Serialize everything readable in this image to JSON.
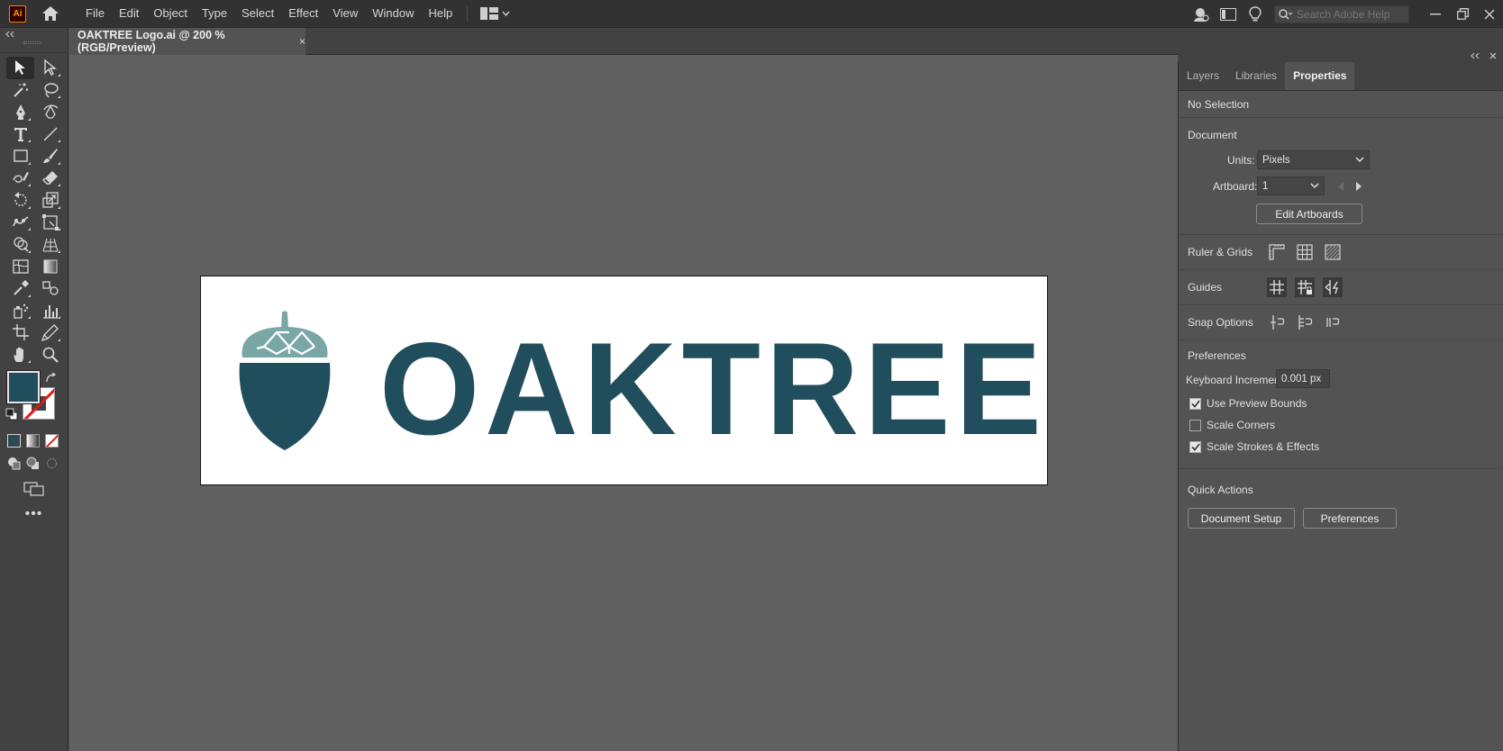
{
  "app": {
    "logo_text": "Ai",
    "menus": [
      "File",
      "Edit",
      "Object",
      "Type",
      "Select",
      "Effect",
      "View",
      "Window",
      "Help"
    ],
    "search_placeholder": "Search Adobe Help"
  },
  "document": {
    "tab_title": "OAKTREE Logo.ai @ 200 % (RGB/Preview)",
    "close_glyph": "×",
    "logo_text": "OAKTREE"
  },
  "colors": {
    "fill": "#214e5c",
    "acorn_cap": "#7aa6a6",
    "canvas": "#616161",
    "accent_red": "#e01b1b"
  },
  "toolbar": {
    "more_label": "•••",
    "tools": [
      "selection-tool",
      "direct-selection-tool",
      "magic-wand-tool",
      "lasso-tool",
      "pen-tool",
      "curvature-tool",
      "type-tool",
      "line-segment-tool",
      "rectangle-tool",
      "paintbrush-tool",
      "shaper-tool",
      "eraser-tool",
      "rotate-tool",
      "scale-tool",
      "puppet-warp-tool",
      "free-transform-tool",
      "shape-builder-tool",
      "perspective-grid-tool",
      "mesh-tool",
      "gradient-tool",
      "eyedropper-tool",
      "blend-tool",
      "symbol-sprayer-tool",
      "column-graph-tool",
      "artboard-tool",
      "slice-tool",
      "hand-tool",
      "zoom-tool"
    ]
  },
  "panel": {
    "tabs": [
      "Layers",
      "Libraries",
      "Properties"
    ],
    "active_tab": "Properties",
    "selection_status": "No Selection",
    "document_heading": "Document",
    "units_label": "Units:",
    "units_value": "Pixels",
    "artboard_label": "Artboard:",
    "artboard_value": "1",
    "edit_artboards_button": "Edit Artboards",
    "ruler_grids_label": "Ruler & Grids",
    "guides_label": "Guides",
    "snap_options_label": "Snap Options",
    "preferences_heading": "Preferences",
    "keyboard_increment_label": "Keyboard Increment:",
    "keyboard_increment_value": "0.001 px",
    "checkboxes": [
      {
        "label": "Use Preview Bounds",
        "checked": true
      },
      {
        "label": "Scale Corners",
        "checked": false
      },
      {
        "label": "Scale Strokes & Effects",
        "checked": true
      }
    ],
    "quick_actions_heading": "Quick Actions",
    "document_setup_button": "Document Setup",
    "preferences_button": "Preferences"
  }
}
